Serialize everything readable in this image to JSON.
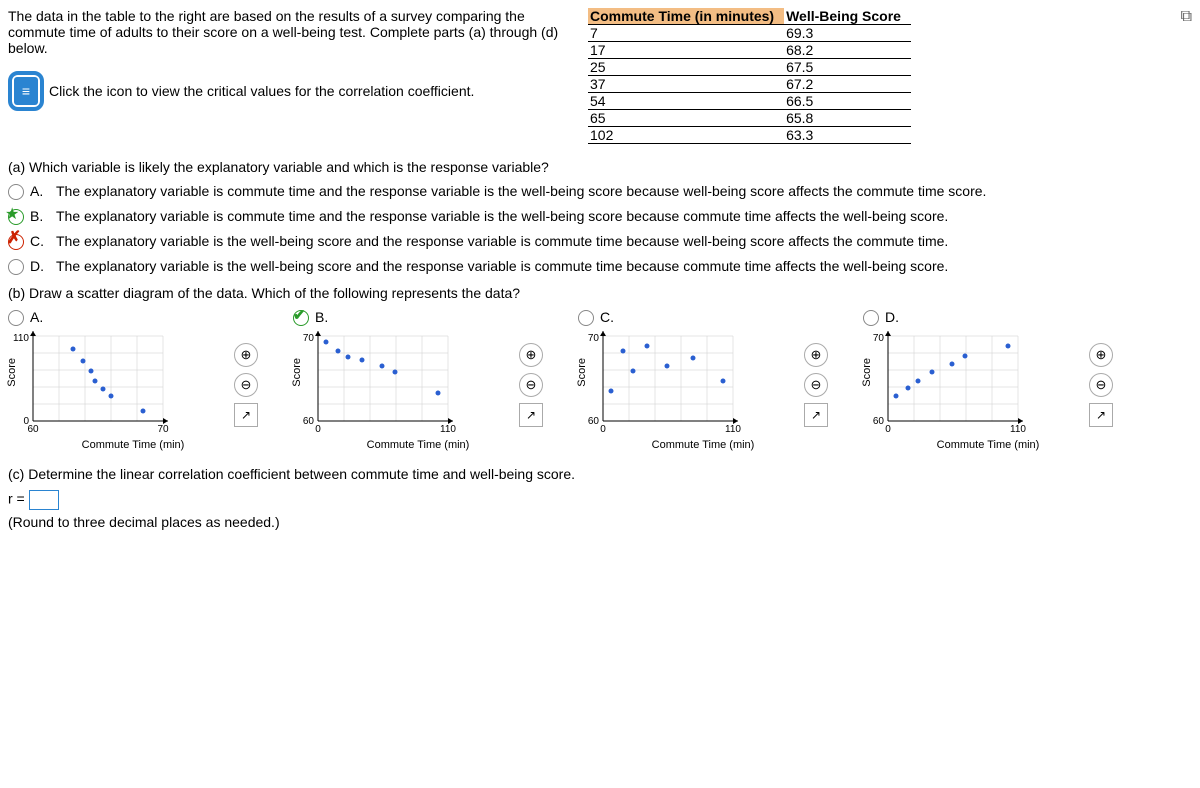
{
  "intro": "The data in the table to the right are based on the results of a survey comparing the commute time of adults to their score on a well-being test. Complete parts (a) through (d) below.",
  "link_text": "Click the icon to view the critical values for the correlation coefficient.",
  "table": {
    "head1": "Commute Time (in minutes)",
    "head2": "Well-Being Score",
    "rows": [
      {
        "x": "7",
        "y": "69.3"
      },
      {
        "x": "17",
        "y": "68.2"
      },
      {
        "x": "25",
        "y": "67.5"
      },
      {
        "x": "37",
        "y": "67.2"
      },
      {
        "x": "54",
        "y": "66.5"
      },
      {
        "x": "65",
        "y": "65.8"
      },
      {
        "x": "102",
        "y": "63.3"
      }
    ]
  },
  "part_a": {
    "question": "(a) Which variable is likely the explanatory variable and which is the response variable?",
    "choices": {
      "A": "The explanatory variable is commute time and the response variable is the well-being score because well-being score affects the commute time score.",
      "B": "The explanatory variable is commute time and the response variable is the well-being score because commute time affects the well-being score.",
      "C": "The explanatory variable is the well-being score and the response variable is commute time because well-being score affects the commute time.",
      "D": "The explanatory variable is the well-being score and the response variable is commute time because commute time affects the well-being score."
    }
  },
  "part_b": {
    "question": "(b) Draw a scatter diagram of the data. Which of the following represents the data?",
    "labels": {
      "A": "A.",
      "B": "B.",
      "C": "C.",
      "D": "D."
    },
    "axis_y": "Score",
    "axis_x": "Commute Time (min)",
    "plot_A": {
      "x0": "60",
      "x1": "70",
      "y0": "0",
      "y1": "110"
    },
    "plot_BCD": {
      "x0": "0",
      "x1": "110",
      "y0": "60",
      "y1": "70"
    }
  },
  "part_c": {
    "question": "(c) Determine the linear correlation coefficient between commute time and well-being score.",
    "prefix": "r = ",
    "hint": "(Round to three decimal places as needed.)"
  },
  "chart_data": {
    "type": "scatter",
    "x": [
      7,
      17,
      25,
      37,
      54,
      65,
      102
    ],
    "y": [
      69.3,
      68.2,
      67.5,
      67.2,
      66.5,
      65.8,
      63.3
    ],
    "xlabel": "Commute Time (min)",
    "ylabel": "Score",
    "plots": [
      {
        "label": "A",
        "xlim": [
          60,
          70
        ],
        "ylim": [
          0,
          110
        ]
      },
      {
        "label": "B",
        "xlim": [
          0,
          110
        ],
        "ylim": [
          60,
          70
        ]
      },
      {
        "label": "C",
        "xlim": [
          0,
          110
        ],
        "ylim": [
          60,
          70
        ]
      },
      {
        "label": "D",
        "xlim": [
          0,
          110
        ],
        "ylim": [
          60,
          70
        ]
      }
    ]
  }
}
